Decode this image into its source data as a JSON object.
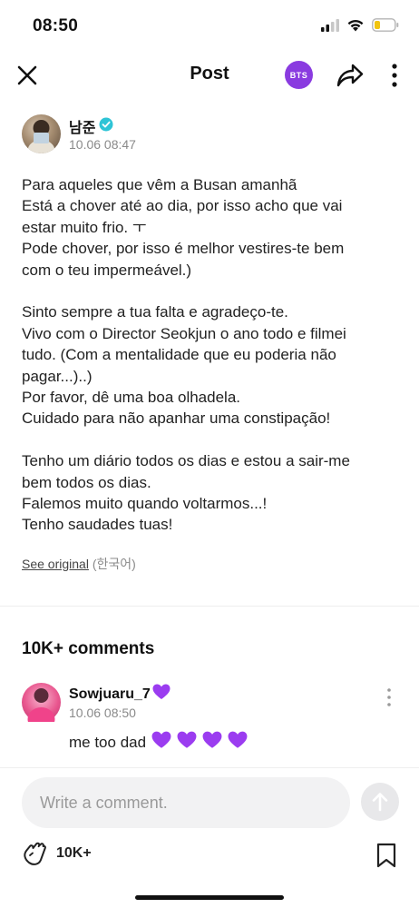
{
  "status_bar": {
    "time": "08:50"
  },
  "header": {
    "title": "Post",
    "badge": "BTS"
  },
  "author": {
    "name": "남준",
    "date": "10.06 08:47"
  },
  "post": {
    "paragraphs": [
      [
        "Para aqueles que vêm a Busan amanhã",
        "Está a chover até ao dia, por isso acho que vai",
        "estar muito frio. ㅜ",
        "Pode chover, por isso é melhor vestires-te bem",
        "com o teu impermeável.)"
      ],
      [
        "Sinto sempre a tua falta e agradeço-te.",
        "Vivo com o Director Seokjun o ano todo e filmei",
        "tudo. (Com a mentalidade que eu poderia não",
        "pagar...)..)",
        "Por favor, dê uma boa olhadela.",
        "Cuidado para não apanhar uma constipação!"
      ],
      [
        "Tenho um diário todos os dias e estou a sair-me",
        "bem todos os dias.",
        "Falemos muito quando voltarmos...!",
        "Tenho saudades tuas!"
      ]
    ],
    "see_original": "See original",
    "language": "(한국어)"
  },
  "comments": {
    "heading": "10K+ comments",
    "items": [
      {
        "user": "Sowjuaru_7",
        "date": "10.06 08:50",
        "text": "me too dad"
      }
    ]
  },
  "composer": {
    "placeholder": "Write a comment.",
    "reaction_count": "10K+"
  },
  "colors": {
    "accent": "#8a3be0",
    "verified": "#2ec4d6",
    "heart": "#9b3cf0"
  }
}
